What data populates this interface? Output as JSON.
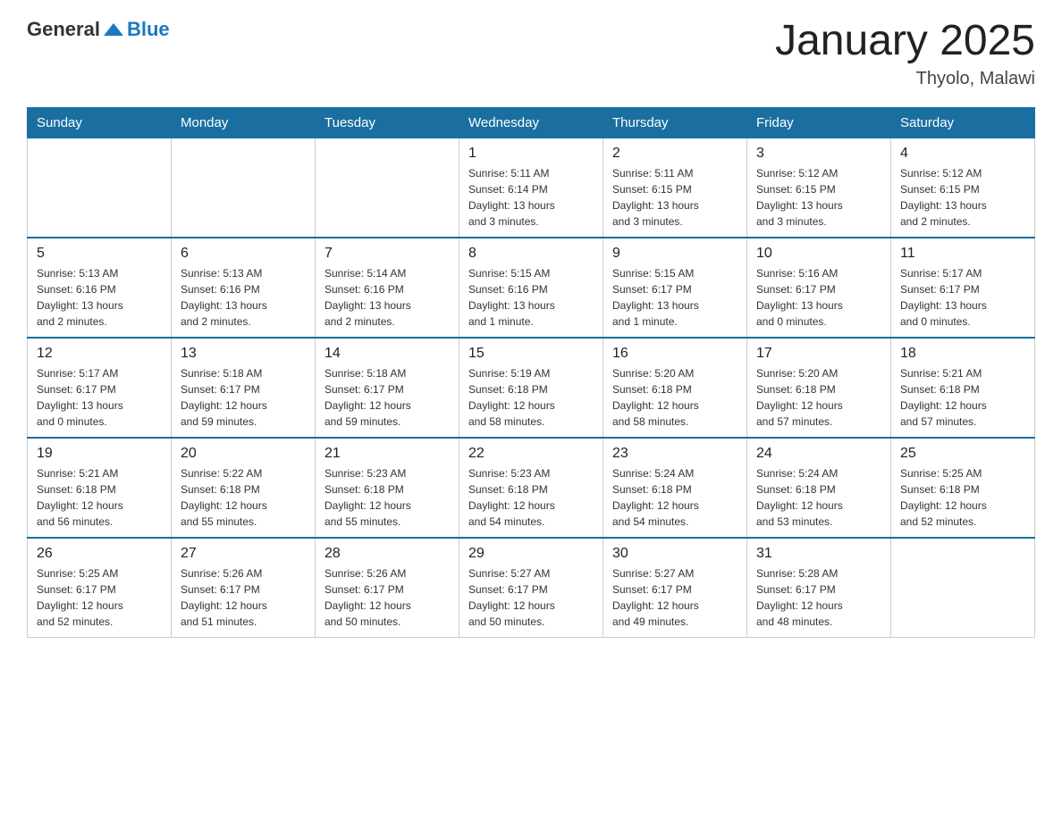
{
  "header": {
    "logo": {
      "general": "General",
      "blue": "Blue"
    },
    "title": "January 2025",
    "subtitle": "Thyolo, Malawi"
  },
  "days_of_week": [
    "Sunday",
    "Monday",
    "Tuesday",
    "Wednesday",
    "Thursday",
    "Friday",
    "Saturday"
  ],
  "weeks": [
    [
      {
        "day": "",
        "info": ""
      },
      {
        "day": "",
        "info": ""
      },
      {
        "day": "",
        "info": ""
      },
      {
        "day": "1",
        "info": "Sunrise: 5:11 AM\nSunset: 6:14 PM\nDaylight: 13 hours\nand 3 minutes."
      },
      {
        "day": "2",
        "info": "Sunrise: 5:11 AM\nSunset: 6:15 PM\nDaylight: 13 hours\nand 3 minutes."
      },
      {
        "day": "3",
        "info": "Sunrise: 5:12 AM\nSunset: 6:15 PM\nDaylight: 13 hours\nand 3 minutes."
      },
      {
        "day": "4",
        "info": "Sunrise: 5:12 AM\nSunset: 6:15 PM\nDaylight: 13 hours\nand 2 minutes."
      }
    ],
    [
      {
        "day": "5",
        "info": "Sunrise: 5:13 AM\nSunset: 6:16 PM\nDaylight: 13 hours\nand 2 minutes."
      },
      {
        "day": "6",
        "info": "Sunrise: 5:13 AM\nSunset: 6:16 PM\nDaylight: 13 hours\nand 2 minutes."
      },
      {
        "day": "7",
        "info": "Sunrise: 5:14 AM\nSunset: 6:16 PM\nDaylight: 13 hours\nand 2 minutes."
      },
      {
        "day": "8",
        "info": "Sunrise: 5:15 AM\nSunset: 6:16 PM\nDaylight: 13 hours\nand 1 minute."
      },
      {
        "day": "9",
        "info": "Sunrise: 5:15 AM\nSunset: 6:17 PM\nDaylight: 13 hours\nand 1 minute."
      },
      {
        "day": "10",
        "info": "Sunrise: 5:16 AM\nSunset: 6:17 PM\nDaylight: 13 hours\nand 0 minutes."
      },
      {
        "day": "11",
        "info": "Sunrise: 5:17 AM\nSunset: 6:17 PM\nDaylight: 13 hours\nand 0 minutes."
      }
    ],
    [
      {
        "day": "12",
        "info": "Sunrise: 5:17 AM\nSunset: 6:17 PM\nDaylight: 13 hours\nand 0 minutes."
      },
      {
        "day": "13",
        "info": "Sunrise: 5:18 AM\nSunset: 6:17 PM\nDaylight: 12 hours\nand 59 minutes."
      },
      {
        "day": "14",
        "info": "Sunrise: 5:18 AM\nSunset: 6:17 PM\nDaylight: 12 hours\nand 59 minutes."
      },
      {
        "day": "15",
        "info": "Sunrise: 5:19 AM\nSunset: 6:18 PM\nDaylight: 12 hours\nand 58 minutes."
      },
      {
        "day": "16",
        "info": "Sunrise: 5:20 AM\nSunset: 6:18 PM\nDaylight: 12 hours\nand 58 minutes."
      },
      {
        "day": "17",
        "info": "Sunrise: 5:20 AM\nSunset: 6:18 PM\nDaylight: 12 hours\nand 57 minutes."
      },
      {
        "day": "18",
        "info": "Sunrise: 5:21 AM\nSunset: 6:18 PM\nDaylight: 12 hours\nand 57 minutes."
      }
    ],
    [
      {
        "day": "19",
        "info": "Sunrise: 5:21 AM\nSunset: 6:18 PM\nDaylight: 12 hours\nand 56 minutes."
      },
      {
        "day": "20",
        "info": "Sunrise: 5:22 AM\nSunset: 6:18 PM\nDaylight: 12 hours\nand 55 minutes."
      },
      {
        "day": "21",
        "info": "Sunrise: 5:23 AM\nSunset: 6:18 PM\nDaylight: 12 hours\nand 55 minutes."
      },
      {
        "day": "22",
        "info": "Sunrise: 5:23 AM\nSunset: 6:18 PM\nDaylight: 12 hours\nand 54 minutes."
      },
      {
        "day": "23",
        "info": "Sunrise: 5:24 AM\nSunset: 6:18 PM\nDaylight: 12 hours\nand 54 minutes."
      },
      {
        "day": "24",
        "info": "Sunrise: 5:24 AM\nSunset: 6:18 PM\nDaylight: 12 hours\nand 53 minutes."
      },
      {
        "day": "25",
        "info": "Sunrise: 5:25 AM\nSunset: 6:18 PM\nDaylight: 12 hours\nand 52 minutes."
      }
    ],
    [
      {
        "day": "26",
        "info": "Sunrise: 5:25 AM\nSunset: 6:17 PM\nDaylight: 12 hours\nand 52 minutes."
      },
      {
        "day": "27",
        "info": "Sunrise: 5:26 AM\nSunset: 6:17 PM\nDaylight: 12 hours\nand 51 minutes."
      },
      {
        "day": "28",
        "info": "Sunrise: 5:26 AM\nSunset: 6:17 PM\nDaylight: 12 hours\nand 50 minutes."
      },
      {
        "day": "29",
        "info": "Sunrise: 5:27 AM\nSunset: 6:17 PM\nDaylight: 12 hours\nand 50 minutes."
      },
      {
        "day": "30",
        "info": "Sunrise: 5:27 AM\nSunset: 6:17 PM\nDaylight: 12 hours\nand 49 minutes."
      },
      {
        "day": "31",
        "info": "Sunrise: 5:28 AM\nSunset: 6:17 PM\nDaylight: 12 hours\nand 48 minutes."
      },
      {
        "day": "",
        "info": ""
      }
    ]
  ]
}
